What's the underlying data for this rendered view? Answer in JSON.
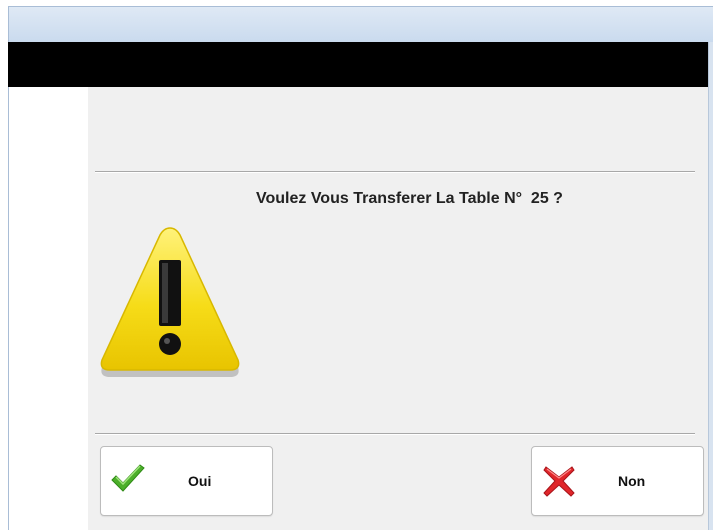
{
  "dialog": {
    "message": "Voulez Vous Transferer La Table N°  25 ?",
    "icon": "warning-icon"
  },
  "buttons": {
    "yes": {
      "label": "Oui",
      "icon": "check-icon",
      "icon_color": "#4caf2a"
    },
    "no": {
      "label": "Non",
      "icon": "cross-icon",
      "icon_color": "#e0262a"
    }
  },
  "colors": {
    "warning_yellow": "#f5d90f",
    "header_bar": "#000000",
    "panel_bg": "#f0f0f0"
  }
}
